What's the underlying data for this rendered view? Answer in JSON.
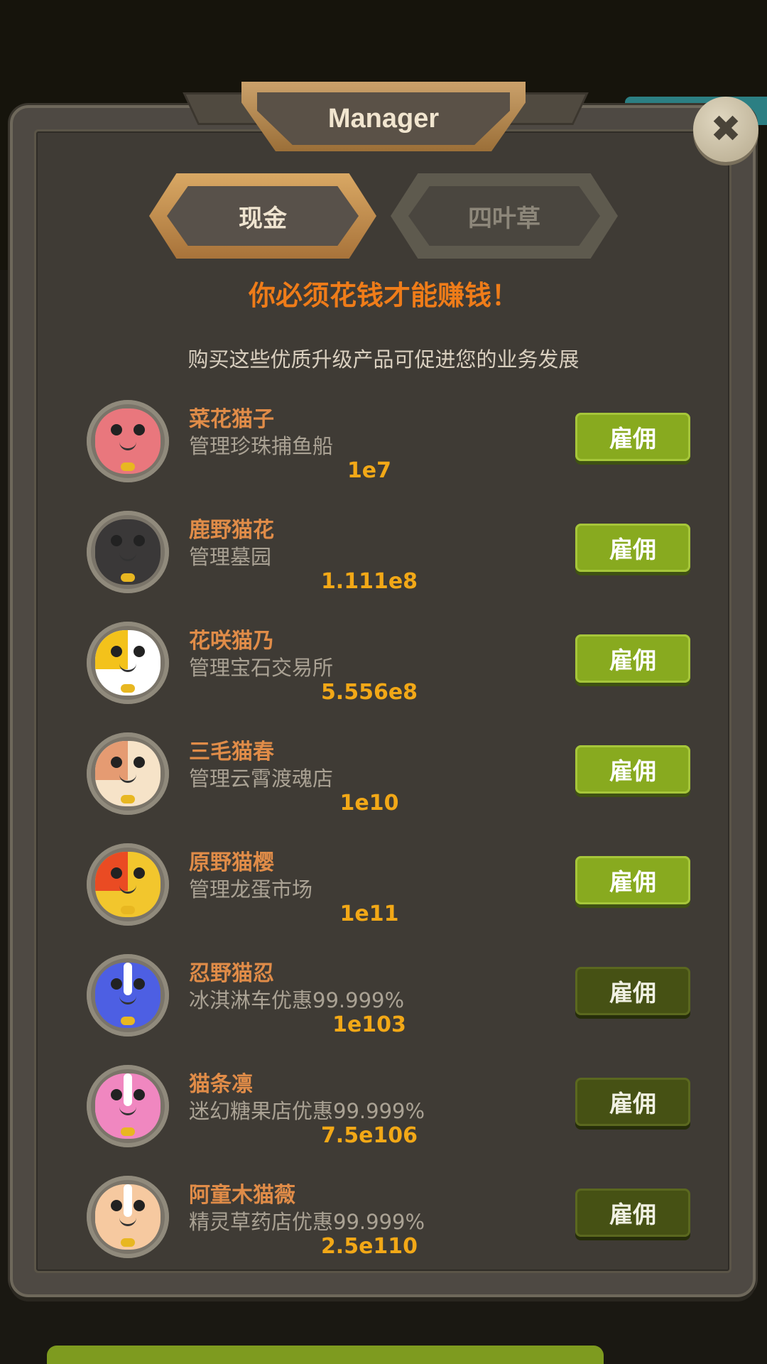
{
  "title": "Manager",
  "close_icon": "close-icon",
  "tabs": [
    {
      "label": "现金",
      "active": true
    },
    {
      "label": "四叶草",
      "active": false
    }
  ],
  "headline": "你必须花钱才能赚钱！",
  "subline": "购买这些优质升级产品可促进您的业务发展",
  "managers": [
    {
      "name": "菜花猫子",
      "desc": "管理珍珠捕鱼船",
      "price": "1e7",
      "button": "雇佣",
      "avatar_colors": [
        "#e9777d",
        "#e9777d"
      ],
      "state": "active"
    },
    {
      "name": "鹿野猫花",
      "desc": "管理墓园",
      "price": "1.111e8",
      "button": "雇佣",
      "avatar_colors": [
        "#3a3838",
        "#3a3838"
      ],
      "state": "active"
    },
    {
      "name": "花咲猫乃",
      "desc": "管理宝石交易所",
      "price": "5.556e8",
      "button": "雇佣",
      "avatar_colors": [
        "#f3c21b",
        "#ffffff"
      ],
      "state": "active"
    },
    {
      "name": "三毛猫春",
      "desc": "管理云霄渡魂店",
      "price": "1e10",
      "button": "雇佣",
      "avatar_colors": [
        "#e59b72",
        "#f6e3c8"
      ],
      "state": "active"
    },
    {
      "name": "原野猫樱",
      "desc": "管理龙蛋市场",
      "price": "1e11",
      "button": "雇佣",
      "avatar_colors": [
        "#ea4b23",
        "#f2c62d"
      ],
      "state": "active"
    },
    {
      "name": "忍野猫忍",
      "desc": "冰淇淋车优惠99.999%",
      "price": "1e103",
      "button": "雇佣",
      "avatar_colors": [
        "#4d5fe3",
        "#4d5fe3"
      ],
      "state": "locked"
    },
    {
      "name": "猫条凛",
      "desc": "迷幻糖果店优惠99.999%",
      "price": "7.5e106",
      "button": "雇佣",
      "avatar_colors": [
        "#f087c0",
        "#f087c0"
      ],
      "state": "locked"
    },
    {
      "name": "阿童木猫薇",
      "desc": "精灵草药店优惠99.999%",
      "price": "2.5e110",
      "button": "雇佣",
      "avatar_colors": [
        "#f6c9a0",
        "#f6c9a0"
      ],
      "state": "locked"
    }
  ]
}
